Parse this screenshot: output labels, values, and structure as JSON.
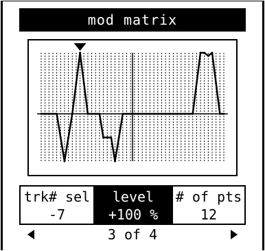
{
  "title": "mod matrix",
  "params": [
    {
      "label": "trk# sel",
      "value": "-7"
    },
    {
      "label": "level",
      "value": "+100 %"
    },
    {
      "label": "# of pts",
      "value": "12"
    }
  ],
  "selected_param": "level",
  "pager": "3 of 4",
  "icons": {
    "marker": "triangle-down-icon",
    "prev": "triangle-left-icon",
    "next": "triangle-right-icon"
  },
  "colors": {
    "foreground": "#000000",
    "background": "#ffffff"
  },
  "chart_data": {
    "type": "line",
    "x": [
      0,
      1,
      2,
      3,
      4,
      5,
      6,
      7,
      8,
      9,
      10,
      11,
      12,
      13,
      14,
      15,
      16,
      17,
      18,
      19,
      20,
      21,
      22,
      23,
      24,
      25,
      26,
      27,
      28,
      29,
      30,
      31,
      32,
      33,
      34,
      35,
      36,
      37,
      38,
      39,
      40,
      41,
      42,
      43,
      44,
      45,
      46,
      47
    ],
    "y": [
      0,
      0,
      0,
      0,
      0,
      -0.5,
      -1,
      -0.5,
      0,
      0.5,
      1,
      0.5,
      0,
      0,
      0,
      0,
      -0.5,
      -0.5,
      -0.5,
      -1,
      -0.5,
      0,
      0,
      0,
      0,
      0,
      0,
      0,
      0,
      0,
      0,
      0,
      0,
      0,
      0,
      0,
      0,
      0,
      0,
      0,
      0.5,
      1,
      1,
      0.95,
      1,
      0.5,
      0,
      0
    ],
    "ylim": [
      -1,
      1
    ],
    "grid": true,
    "marker_index": 10
  }
}
